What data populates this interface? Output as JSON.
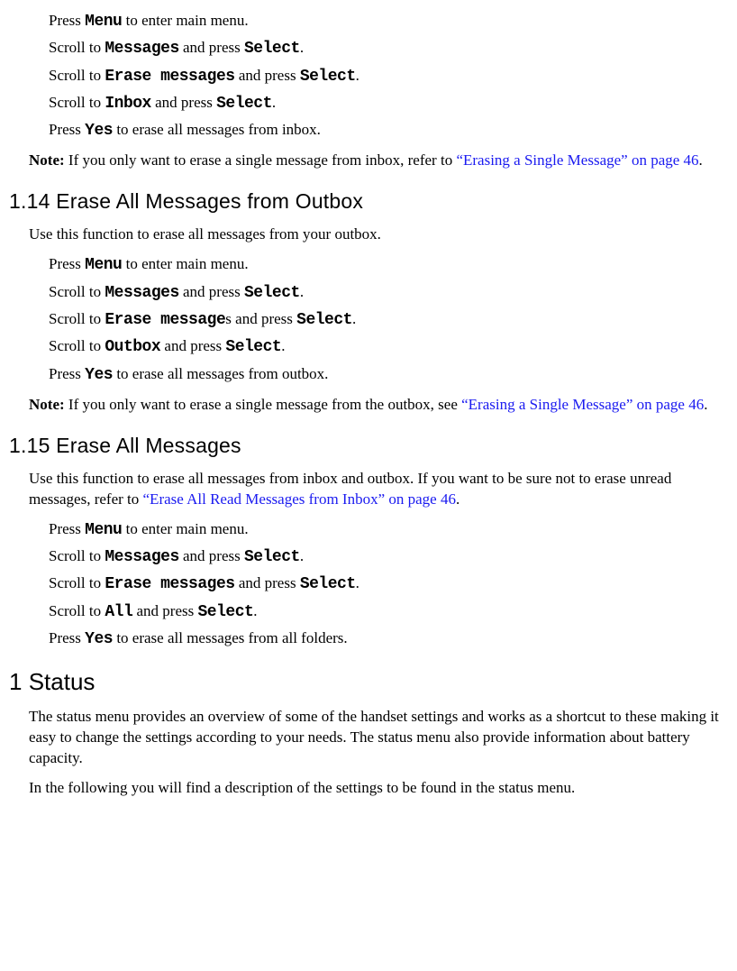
{
  "inbox_steps": {
    "s1_a": "Press ",
    "s1_b": "Menu",
    "s1_c": " to enter main menu.",
    "s2_a": "Scroll to ",
    "s2_b": "Messages",
    "s2_c": " and press ",
    "s2_d": "Select",
    "s2_e": ".",
    "s3_a": "Scroll to ",
    "s3_b": "Erase messages",
    "s3_c": " and press ",
    "s3_d": "Select",
    "s3_e": ".",
    "s4_a": "Scroll to ",
    "s4_b": "Inbox",
    "s4_c": " and press ",
    "s4_d": "Select",
    "s4_e": ".",
    "s5_a": "Press ",
    "s5_b": "Yes",
    "s5_c": " to erase all messages from inbox."
  },
  "inbox_note": {
    "label": "Note:",
    "text": " If you only want to erase a single message from inbox, refer to ",
    "link": "“Erasing a Single Message” on page 46",
    "after": "."
  },
  "sec114": {
    "num": "1.14",
    "title": "  Erase All Messages from Outbox",
    "intro": "Use this function to erase all messages from your outbox."
  },
  "outbox_steps": {
    "s1_a": "Press ",
    "s1_b": "Menu",
    "s1_c": " to enter main menu.",
    "s2_a": "Scroll to ",
    "s2_b": "Messages",
    "s2_c": " and press ",
    "s2_d": "Select",
    "s2_e": ".",
    "s3_a": "Scroll to ",
    "s3_b": "Erase message",
    "s3_b2": "s",
    "s3_c": " and press ",
    "s3_d": "Select",
    "s3_e": ".",
    "s4_a": "Scroll to ",
    "s4_b": "Outbox",
    "s4_c": " and press ",
    "s4_d": "Select",
    "s4_e": ".",
    "s5_a": "Press ",
    "s5_b": "Yes",
    "s5_c": " to erase all messages from outbox."
  },
  "outbox_note": {
    "label": "Note:",
    "text": " If you only want to erase a single message from the outbox, see ",
    "link": "“Erasing a Single Message” on page 46",
    "after": "."
  },
  "sec115": {
    "num": "1.15",
    "title": "  Erase All Messages",
    "intro_a": "Use this function to erase all messages from inbox and outbox. If you want to be sure not to erase unread messages, refer to ",
    "intro_link": "“Erase All Read Messages from Inbox” on page 46",
    "intro_b": "."
  },
  "all_steps": {
    "s1_a": "Press ",
    "s1_b": "Menu",
    "s1_c": " to enter main menu.",
    "s2_a": "Scroll to ",
    "s2_b": "Messages",
    "s2_c": " and press ",
    "s2_d": "Select",
    "s2_e": ".",
    "s3_a": "Scroll to ",
    "s3_b": "Erase messages",
    "s3_c": " and press ",
    "s3_d": "Select",
    "s3_e": ".",
    "s4_a": "Scroll to ",
    "s4_b": "All",
    "s4_c": " and press ",
    "s4_d": "Select",
    "s4_e": ".",
    "s5_a": "Press ",
    "s5_b": "Yes",
    "s5_c": " to erase all messages from all folders."
  },
  "status": {
    "num": "1",
    "title": " Status",
    "p1": "The status menu provides an overview of some of the handset settings and works as a shortcut to these making it easy to change the settings according to your needs. The status menu also provide information about battery capacity.",
    "p2": "In the following you will find a description of the settings to be found in the status menu."
  }
}
